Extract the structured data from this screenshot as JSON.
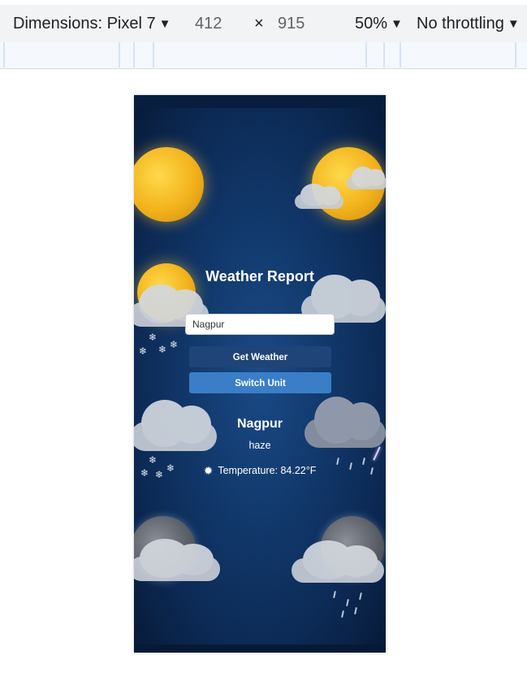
{
  "devtools": {
    "dimensions_label": "Dimensions: Pixel 7",
    "width": "412",
    "times": "×",
    "height": "915",
    "zoom": "50%",
    "throttling": "No throttling",
    "caret": "▼"
  },
  "app": {
    "title": "Weather Report",
    "input": {
      "value": "Nagpur",
      "placeholder": ""
    },
    "buttons": {
      "get_weather": "Get Weather",
      "switch_unit": "Switch Unit"
    },
    "result": {
      "city": "Nagpur",
      "description": "haze",
      "temperature": "Temperature: 84.22°F",
      "temperature_icon": "sun-icon"
    }
  },
  "colors": {
    "background_dark": "#0c2a55",
    "get_weather_button": "#1e4478",
    "switch_unit_button": "#3a7ec8",
    "text": "#ffffff"
  }
}
